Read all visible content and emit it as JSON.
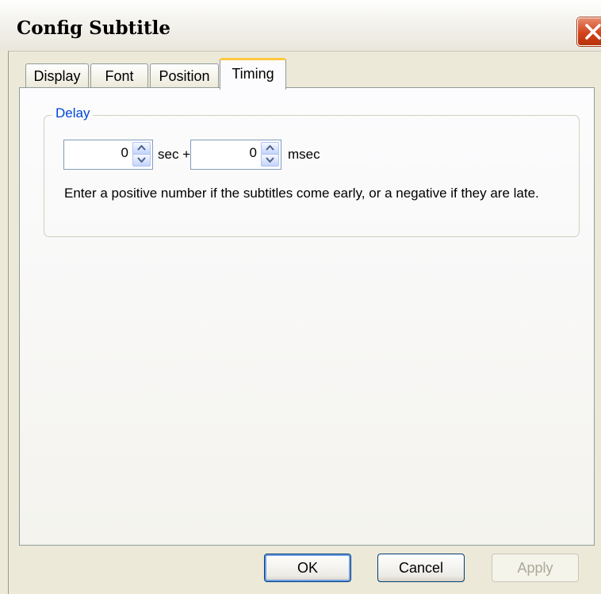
{
  "window": {
    "title": "Config Subtitle"
  },
  "tabs": [
    {
      "label": "Display"
    },
    {
      "label": "Font"
    },
    {
      "label": "Position"
    },
    {
      "label": "Timing",
      "active": true
    }
  ],
  "delay": {
    "group_label": "Delay",
    "seconds_value": "0",
    "seconds_suffix": "sec +",
    "msec_value": "0",
    "msec_suffix": "msec",
    "description": "Enter a positive number if the subtitles come early, or a negative if they are late."
  },
  "buttons": {
    "ok": "OK",
    "cancel": "Cancel",
    "apply": "Apply"
  },
  "colors": {
    "accent_tab": "#ffc83c",
    "group_label": "#0046d5",
    "close_button": "#d1441c"
  },
  "icons": {
    "close": "close-icon",
    "spin_up": "up-arrow-icon",
    "spin_down": "down-arrow-icon"
  }
}
